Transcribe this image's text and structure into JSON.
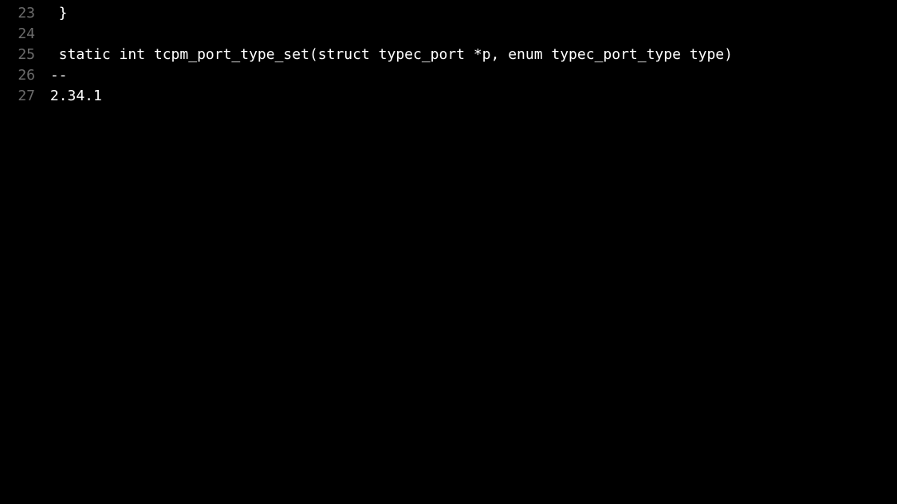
{
  "lines": [
    {
      "num": "23",
      "text": "  }"
    },
    {
      "num": "24",
      "text": " "
    },
    {
      "num": "25",
      "text": "  static int tcpm_port_type_set(struct typec_port *p, enum typec_port_type type)"
    },
    {
      "num": "26",
      "text": " -- "
    },
    {
      "num": "27",
      "text": " 2.34.1"
    }
  ]
}
